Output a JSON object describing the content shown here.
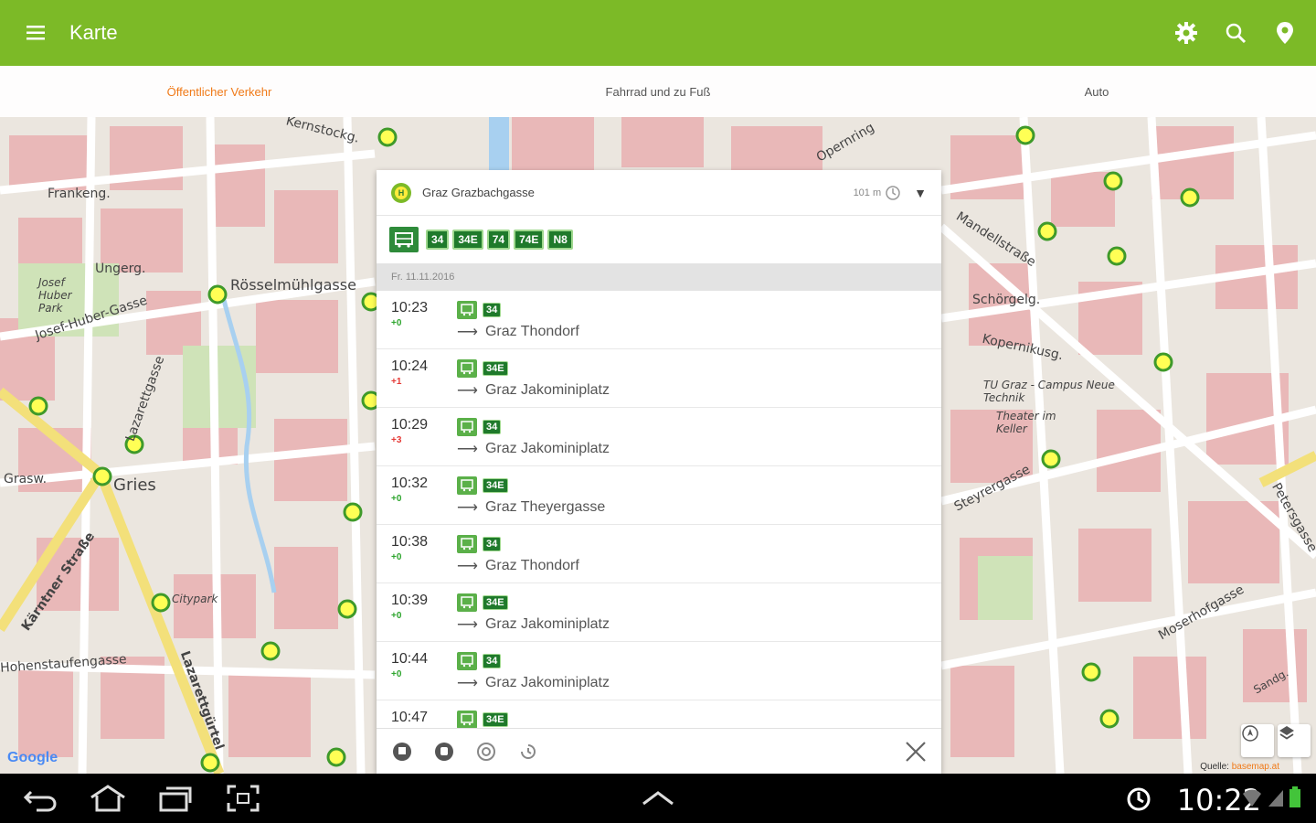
{
  "appbar": {
    "title": "Karte"
  },
  "tabs": [
    {
      "label": "Öffentlicher Verkehr",
      "active": true
    },
    {
      "label": "Fahrrad und zu Fuß",
      "active": false
    },
    {
      "label": "Auto",
      "active": false
    }
  ],
  "map": {
    "labels": {
      "kernstock": "Kernstockg.",
      "frankeng": "Frankeng.",
      "ungerg": "Ungerg.",
      "josef_huber_park": "Josef Huber Park",
      "josef_huber_gasse": "Josef-Huber-Gasse",
      "rosselmuhlgasse": "Rösselmühlgasse",
      "gries": "Gries",
      "karntner": "Kärntner Straße",
      "lazarettgasse": "Lazarettgasse",
      "hohenstaufengasse": "Hohenstaufengasse",
      "lazarettgurtel": "Lazarettgürtel",
      "citypark": "Citypark",
      "opernring": "Opernring",
      "mandellstrasse": "Mandellstraße",
      "schorgelg": "Schörgelg.",
      "kopernikusg": "Kopernikusg.",
      "tu_graz": "TU Graz - Campus Neue Technik",
      "theater": "Theater im Keller",
      "steyrergasse": "Steyrergasse",
      "moserhofgasse": "Moserhofgasse",
      "petersgasse": "Petersgasse",
      "sandg": "Sandg.",
      "griesplatz": "Grasw."
    },
    "google_label": "Google",
    "source_label": "Quelle:",
    "source_link": "basemap.at"
  },
  "panel": {
    "stop_name": "Graz Grazbachgasse",
    "distance": "101 m",
    "lines": [
      "34",
      "34E",
      "74",
      "74E",
      "N8"
    ],
    "date": "Fr. 11.11.2016",
    "departures": [
      {
        "time": "10:23",
        "delay": "+0",
        "delay_color": "#2ea52e",
        "line": "34",
        "destination": "Graz Thondorf"
      },
      {
        "time": "10:24",
        "delay": "+1",
        "delay_color": "#e53935",
        "line": "34E",
        "destination": "Graz Jakominiplatz"
      },
      {
        "time": "10:29",
        "delay": "+3",
        "delay_color": "#e53935",
        "line": "34",
        "destination": "Graz Jakominiplatz"
      },
      {
        "time": "10:32",
        "delay": "+0",
        "delay_color": "#2ea52e",
        "line": "34E",
        "destination": "Graz Theyergasse"
      },
      {
        "time": "10:38",
        "delay": "+0",
        "delay_color": "#2ea52e",
        "line": "34",
        "destination": "Graz Thondorf"
      },
      {
        "time": "10:39",
        "delay": "+0",
        "delay_color": "#2ea52e",
        "line": "34E",
        "destination": "Graz Jakominiplatz"
      },
      {
        "time": "10:44",
        "delay": "+0",
        "delay_color": "#2ea52e",
        "line": "34",
        "destination": "Graz Jakominiplatz"
      },
      {
        "time": "10:47",
        "delay": "",
        "delay_color": "#2ea52e",
        "line": "34E",
        "destination": ""
      }
    ]
  },
  "system": {
    "clock": "10:22"
  },
  "colors": {
    "appbar": "#7cba27",
    "accent": "#f07a18",
    "line_badge": "#1f7a2b"
  }
}
